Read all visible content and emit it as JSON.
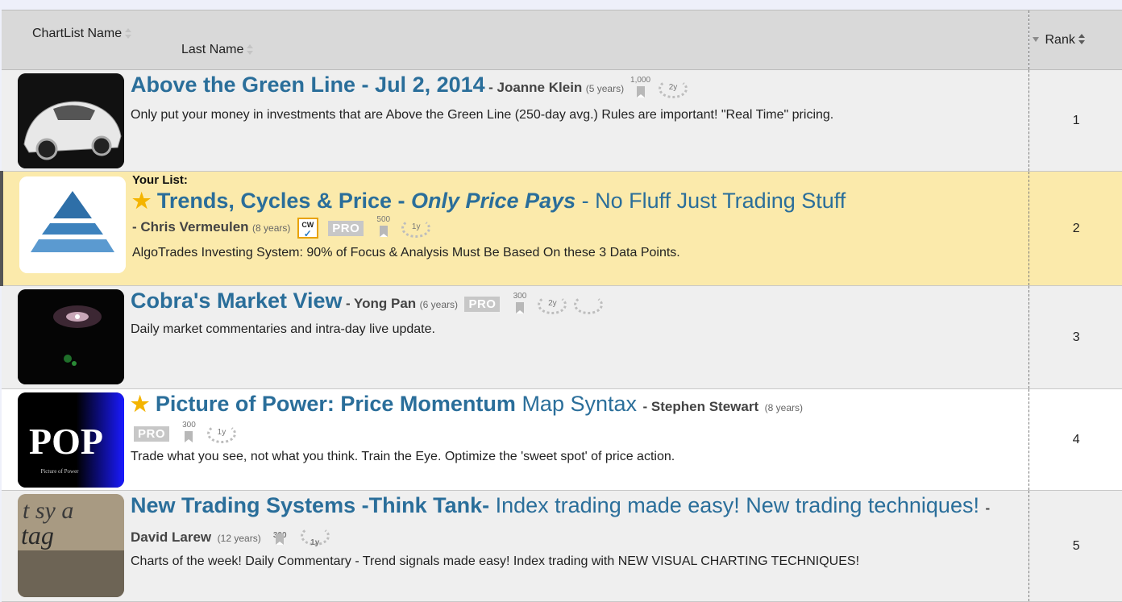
{
  "header": {
    "chartlist_name": "ChartList Name",
    "last_name": "Last Name",
    "rank": "Rank"
  },
  "rows": [
    {
      "title": "Above the Green Line - Jul 2, 2014",
      "author": "- Joanne Klein",
      "years": "(5 years)",
      "bookmarks": "1,000",
      "laurels": [
        "2y"
      ],
      "description": "Only put your money in investments that are Above the Green Line (250-day avg.) Rules are important! \"Real Time\" pricing.",
      "rank": "1"
    },
    {
      "your_list": "Your List:",
      "title_bold": "Trends, Cycles & Price -",
      "title_italic": "Only Price Pays",
      "title_plain": "- No Fluff Just Trading Stuff",
      "author": "- Chris Vermeulen",
      "years": "(8 years)",
      "cw_badge": "CW",
      "pro": "PRO",
      "bookmarks": "500",
      "laurels": [
        "1y"
      ],
      "description": "AlgoTrades Investing System: 90% of Focus & Analysis Must Be Based On these 3 Data Points.",
      "rank": "2"
    },
    {
      "title_plain": "Cobra's Market View",
      "author": "- Yong Pan",
      "years": "(6 years)",
      "pro": "PRO",
      "bookmarks": "300",
      "laurels": [
        "2y",
        ""
      ],
      "description": "Daily market commentaries and intra-day live update.",
      "rank": "3"
    },
    {
      "title_bold": "Picture of Power: Price Momentum",
      "title_plain": "Map Syntax",
      "author": "- Stephen Stewart",
      "years": "(8 years)",
      "pro": "PRO",
      "bookmarks": "300",
      "laurels": [
        "1y"
      ],
      "thumb_text": "POP",
      "thumb_sub": "Picture of Power",
      "description": "Trade what you see, not what you think. Train the Eye. Optimize the 'sweet spot' of price action.",
      "rank": "4"
    },
    {
      "title_bold": "New Trading Systems -Think Tank-",
      "title_plain": "Index trading made easy! New trading techniques!",
      "author": "- David Larew",
      "years": "(12 years)",
      "bookmarks": "300",
      "laurels": [
        "1y"
      ],
      "thumb_text": "t sy a",
      "thumb_sub": "tag",
      "description": "Charts of the week! Daily Commentary - Trend signals made easy! Index trading with NEW VISUAL CHARTING TECHNIQUES!",
      "rank": "5"
    }
  ]
}
